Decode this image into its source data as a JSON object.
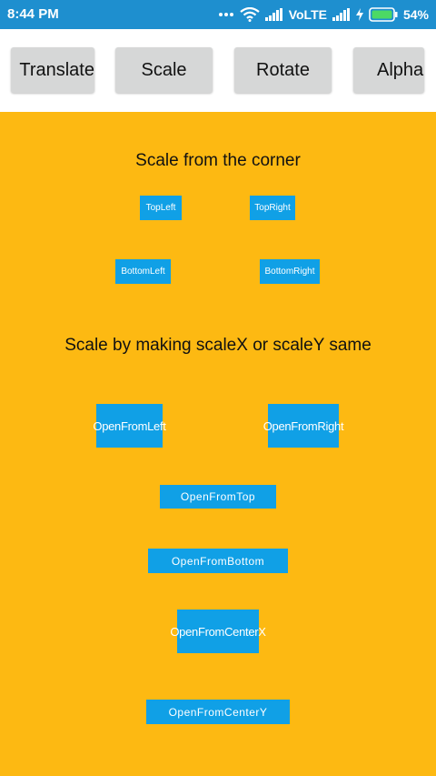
{
  "status_bar": {
    "time": "8:44 PM",
    "network": "VoLTE",
    "battery": "54%",
    "icons": [
      "more-dots-icon",
      "wifi-icon",
      "signal-icon",
      "signal-icon",
      "charging-icon",
      "battery-icon"
    ],
    "colors": {
      "background": "#1e8fcf",
      "battery_fill": "#4cd964"
    }
  },
  "tabs": [
    {
      "label": "Translate"
    },
    {
      "label": "Scale"
    },
    {
      "label": "Rotate"
    },
    {
      "label": "Alpha"
    }
  ],
  "main": {
    "background": "#fdb912",
    "button_color": "#10a0e6",
    "heading_corner": "Scale from the corner",
    "corner_buttons": {
      "top_left": "TopLeft",
      "top_right": "TopRight",
      "bottom_left": "BottomLeft",
      "bottom_right": "BottomRight"
    },
    "heading_same": "Scale by making scaleX or scaleY same",
    "open_buttons": {
      "left": "OpenFromLeft",
      "right": "OpenFromRight",
      "top": "OpenFromTop",
      "bottom": "OpenFromBottom",
      "center_x": "OpenFromCenterX",
      "center_y": "OpenFromCenterY"
    }
  }
}
